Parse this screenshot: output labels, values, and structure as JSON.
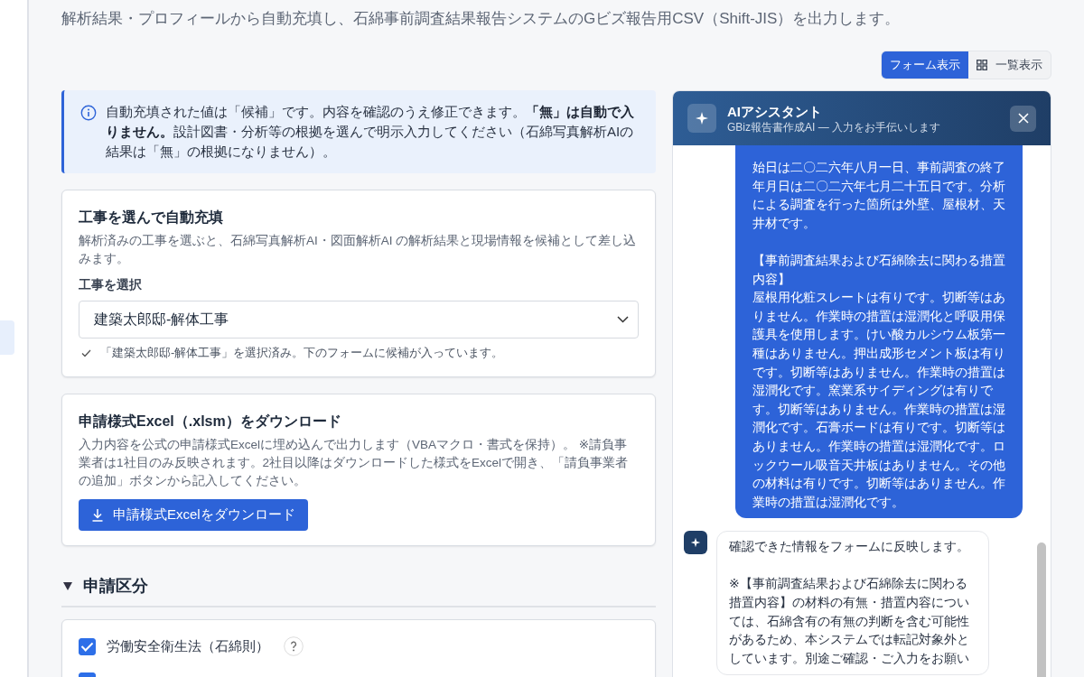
{
  "subtitle": "解析結果・プロフィールから自動充填し、石綿事前調査結果報告システムのGビズ報告用CSV（Shift-JIS）を出力します。",
  "view_toggle": [
    {
      "label": "フォーム表示",
      "kind": "form",
      "selected": true
    },
    {
      "label": "一覧表示",
      "kind": "list",
      "selected": false
    }
  ],
  "notice": "自動充填された値は「候補」です。内容を確認のうえ修正できます。**「無」は自動で入りません。**設計図書・分析等の根拠を選んで明示入力してください（石綿写真解析AIの結果は「無」の根拠になりません）。",
  "autofill_card": {
    "title": "工事を選んで自動充填",
    "description": "解析済みの工事を選ぶと、石綿写真解析AI・図面解析AI の解析結果と現場情報を候補として差し込みます。",
    "field_label": "工事を選択",
    "select_value": "建築太郎邸-解体工事",
    "status": "「建築太郎邸-解体工事」を選択済み。下のフォームに候補が入っています。"
  },
  "excel_card": {
    "title": "申請様式Excel（.xlsm）をダウンロード",
    "description": "入力内容を公式の申請様式Excelに埋め込んで出力します（VBAマクロ・書式を保持）。 ※請負事業者は1社目のみ反映されます。2社目以降はダウンロードした様式をExcelで開き、「請負事業者の追加」ボタンから記入してください。",
    "button": "申請様式Excelをダウンロード"
  },
  "section": {
    "title": "申請区分",
    "expanded": true,
    "items": [
      {
        "label": "労働安全衛生法（石綿則）",
        "checked": true
      },
      {
        "checked": true
      }
    ]
  },
  "assistant": {
    "title": "AIアシスタント",
    "subtitle": "GBiz報告書作成AI — 入力をお手伝いします",
    "messages": [
      {
        "kind": "user",
        "paragraphs": [
          [
            "始日は二〇二六年八月一日、事前調査の終了年月日は二〇二六年七月二十五日です。分析による調査を行った箇所は外壁、屋根材、天井材です。"
          ],
          [
            "【事前調査結果および石綿除去に関わる措置内容】",
            "屋根用化粧スレートは有りです。切断等はありません。作業時の措置は湿潤化と呼吸用保護具を使用します。けい酸カルシウム板第一種はありません。押出成形セメント板は有りです。切断等はありません。作業時の措置は湿潤化です。窯業系サイディングは有りです。切断等はありません。作業時の措置は湿潤化です。石膏ボードは有りです。切断等はありません。作業時の措置は湿潤化です。ロックウール吸音天井板はありません。その他の材料は有りです。切断等はありません。作業時の措置は湿潤化です。"
          ]
        ]
      },
      {
        "kind": "assistant",
        "paragraphs": [
          [
            "確認できた情報をフォームに反映します。"
          ],
          [
            "※【事前調査結果および石綿除去に関わる措置内容】の材料の有無・措置内容については、石綿含有の有無の判断を含む可能性があるため、本システムでは転記対象外としています。別途ご確認・ご入力をお願い"
          ]
        ]
      }
    ]
  }
}
